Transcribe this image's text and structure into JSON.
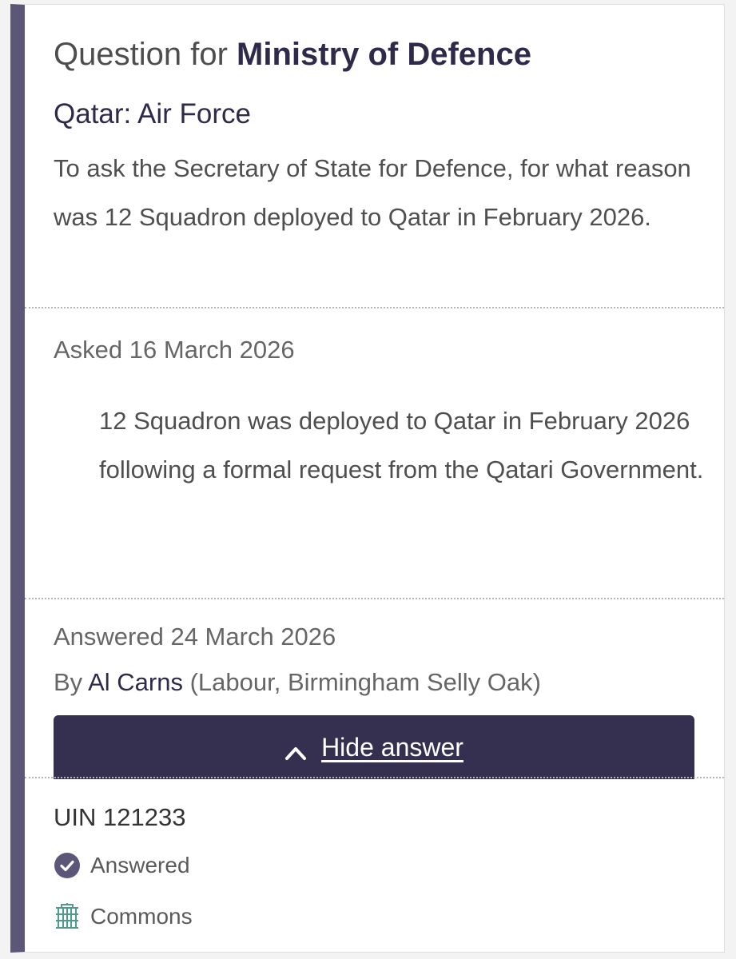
{
  "header": {
    "prefix": "Question for",
    "department": "Ministry of Defence"
  },
  "question": {
    "subject": "Qatar: Air Force",
    "text": "To ask the Secretary of State for Defence, for what reason was 12 Squadron deployed to Qatar in February 2026."
  },
  "asked": {
    "label": "Asked 16 March 2026"
  },
  "answer": {
    "text": "12 Squadron was deployed to Qatar in February 2026 following a formal request from the Qatari Government.",
    "answered_label": "Answered 24 March 2026",
    "by_prefix": "By",
    "member_name": "Al Carns",
    "member_detail": "(Labour, Birmingham Selly Oak)"
  },
  "toggle": {
    "label": "Hide answer",
    "icon": "chevron-up-icon"
  },
  "meta": {
    "uin": "UIN 121233",
    "status_label": "Answered",
    "status_icon": "check-circle-icon",
    "house_label": "Commons",
    "house_icon": "portcullis-icon"
  },
  "colors": {
    "accent": "#5c5679",
    "button": "#35304f",
    "heading": "#2f2a4a",
    "house_icon": "#4f9b8f"
  }
}
